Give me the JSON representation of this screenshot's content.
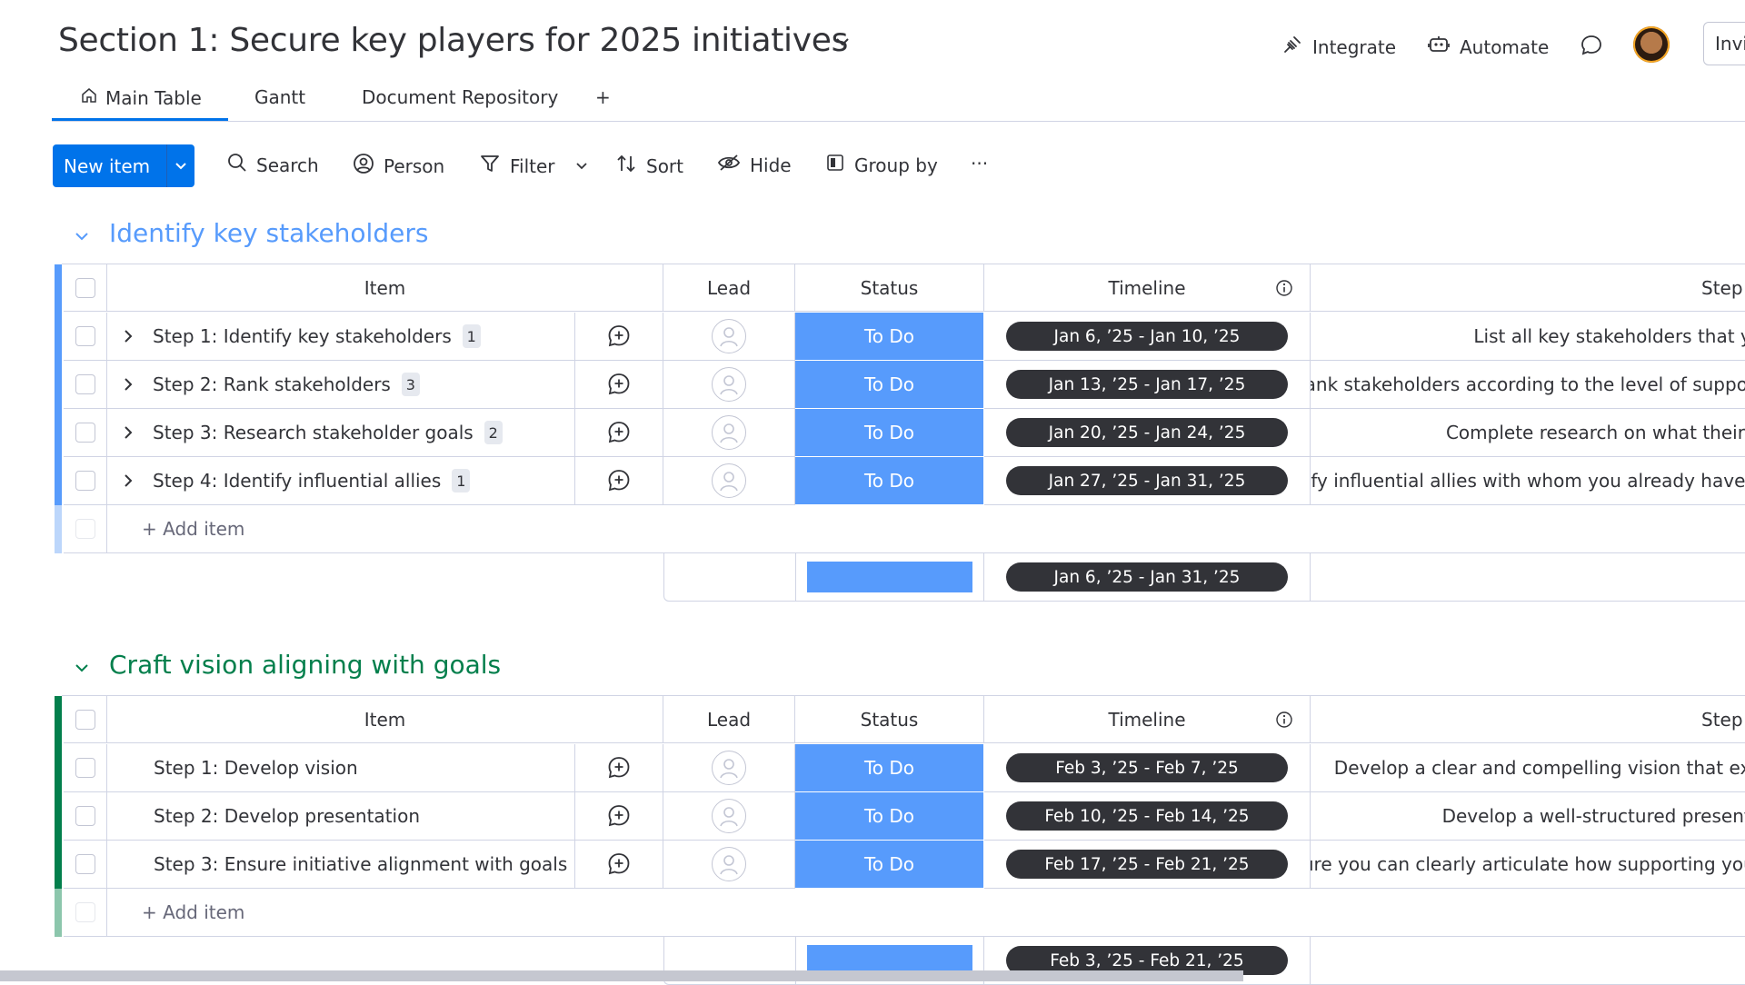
{
  "header": {
    "title": "Section 1: Secure key players for 2025 initiatives",
    "integrate_label": "Integrate",
    "automate_label": "Automate",
    "invite_label": "Invi"
  },
  "tabs": [
    {
      "label": "Main Table"
    },
    {
      "label": "Gantt"
    },
    {
      "label": "Document Repository"
    },
    {
      "label": "+"
    }
  ],
  "toolbar": {
    "new_item_label": "New item",
    "search_label": "Search",
    "person_label": "Person",
    "filter_label": "Filter",
    "sort_label": "Sort",
    "hide_label": "Hide",
    "group_by_label": "Group by",
    "more_label": "···"
  },
  "columns": {
    "item": "Item",
    "lead": "Lead",
    "status": "Status",
    "timeline": "Timeline",
    "step": "Step"
  },
  "colors": {
    "accent": "#0073ea",
    "status_todo": "#579bfc",
    "group1": "#579bfc",
    "group2": "#037f4c"
  },
  "groups": [
    {
      "title": "Identify key stakeholders",
      "add_item_label": "+ Add item",
      "summary_timeline": "Jan 6, ’25 - Jan 31, ’25",
      "rows": [
        {
          "name": "Step 1: Identify key stakeholders",
          "count": "1",
          "status": "To Do",
          "timeline": "Jan 6, ’25 - Jan 10, ’25",
          "step": "List all key stakeholders that yo"
        },
        {
          "name": "Step 2: Rank stakeholders",
          "count": "3",
          "status": "To Do",
          "timeline": "Jan 13, ’25 - Jan 17, ’25",
          "step": "Rank stakeholders according to the level of support"
        },
        {
          "name": "Step 3: Research stakeholder goals",
          "count": "2",
          "status": "To Do",
          "timeline": "Jan 20, ’25 - Jan 24, ’25",
          "step": "Complete research on what their g"
        },
        {
          "name": "Step 4: Identify influential allies",
          "count": "1",
          "status": "To Do",
          "timeline": "Jan 27, ’25 - Jan 31, ’25",
          "step": "Identify influential allies with whom you already have a"
        }
      ]
    },
    {
      "title": "Craft vision aligning with goals",
      "add_item_label": "+ Add item",
      "summary_timeline": "Feb 3, ’25 - Feb 21, ’25",
      "rows": [
        {
          "name": "Step 1: Develop vision",
          "status": "To Do",
          "timeline": "Feb 3, ’25 - Feb 7, ’25",
          "step": "Develop a clear and compelling vision that exp"
        },
        {
          "name": "Step 2: Develop presentation",
          "status": "To Do",
          "timeline": "Feb 10, ’25 - Feb 14, ’25",
          "step": "Develop a well-structured presenta"
        },
        {
          "name": "Step 3: Ensure initiative alignment with goals",
          "status": "To Do",
          "timeline": "Feb 17, ’25 - Feb 21, ’25",
          "step": "Be sure you can clearly articulate how supporting your"
        }
      ]
    }
  ]
}
